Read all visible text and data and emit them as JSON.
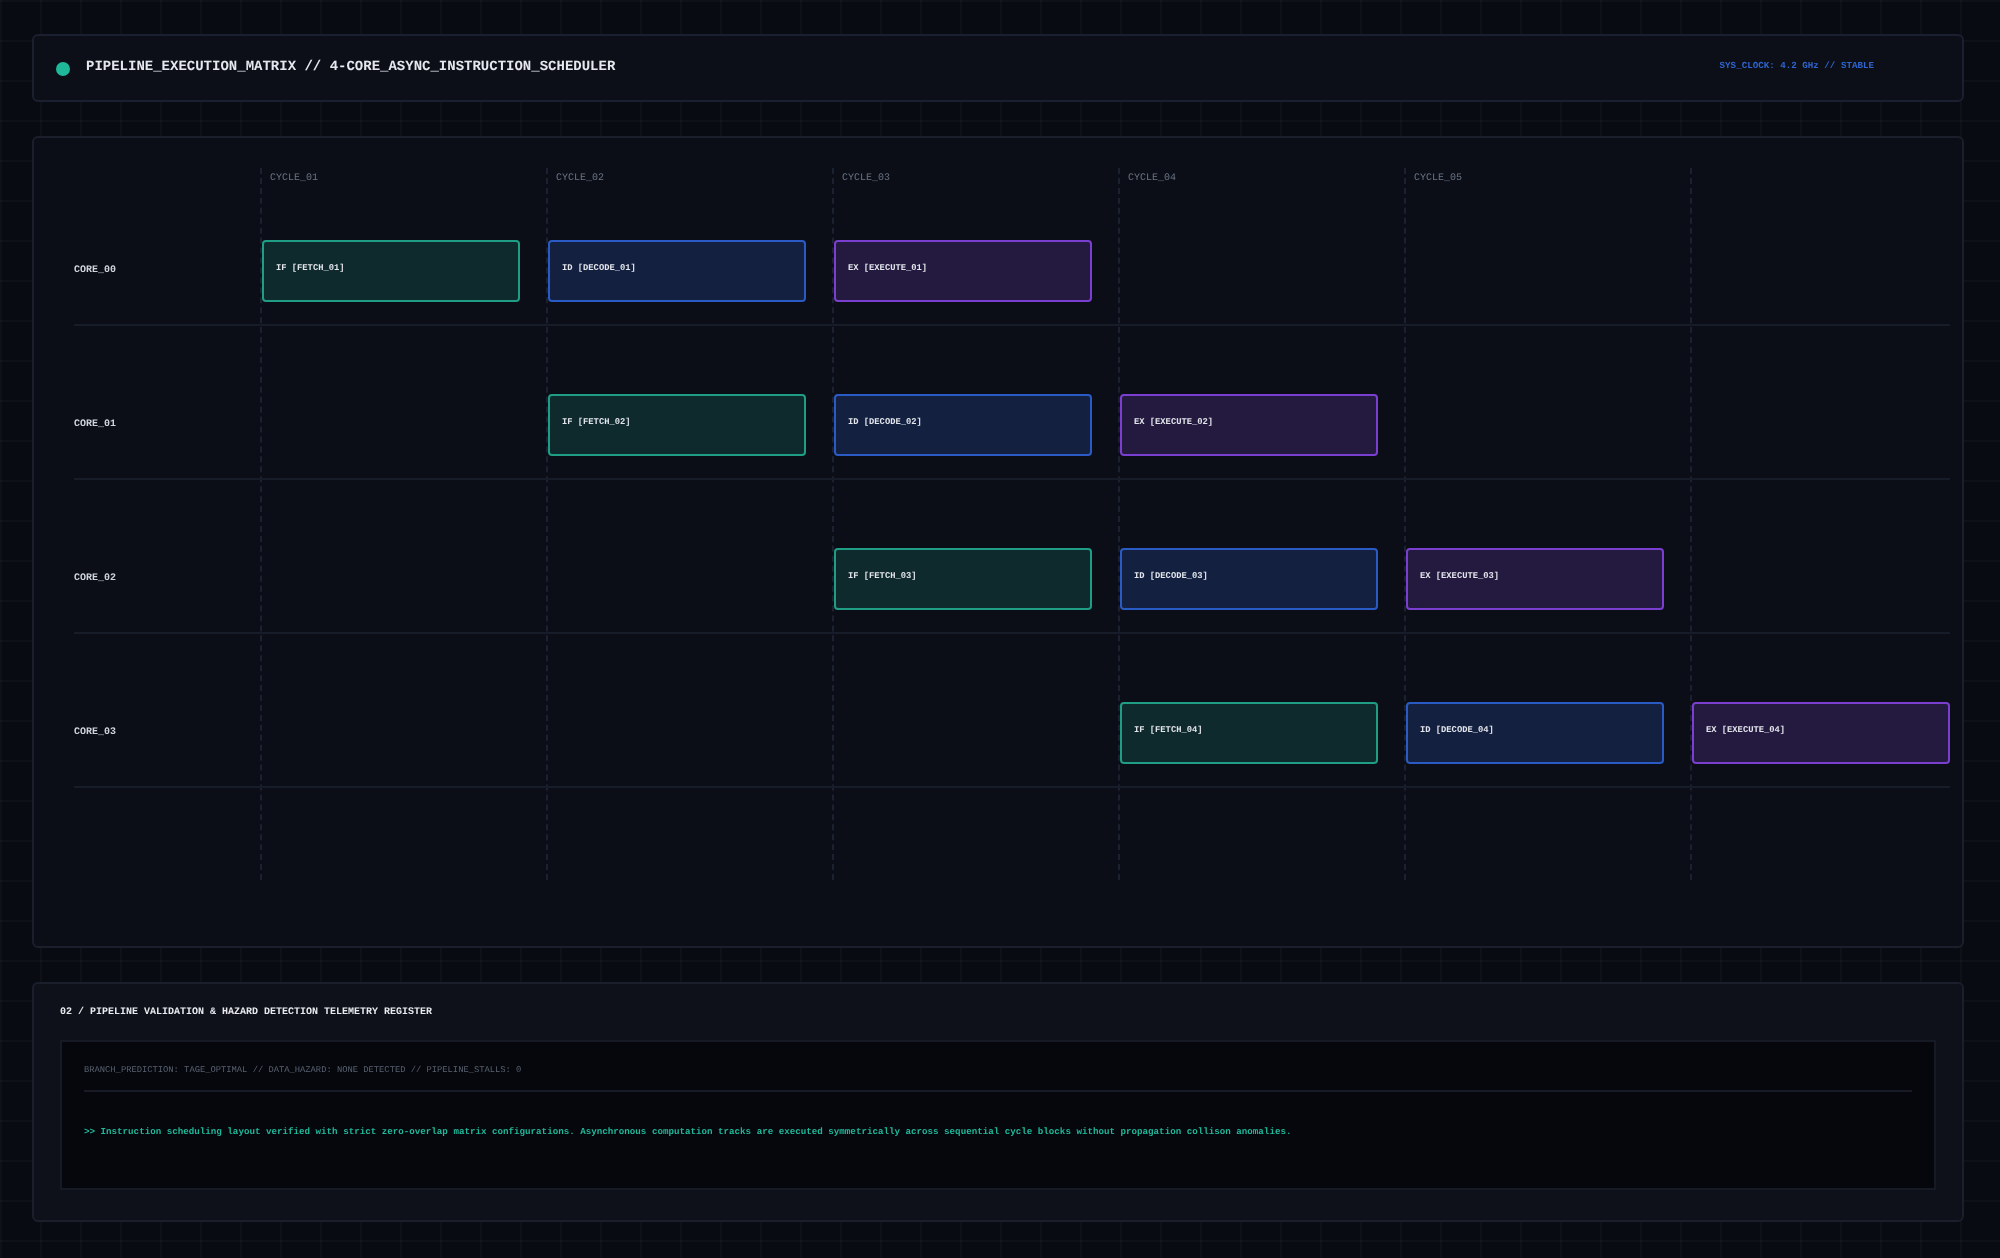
{
  "header": {
    "title": "PIPELINE_EXECUTION_MATRIX // 4-CORE_ASYNC_INSTRUCTION_SCHEDULER",
    "clock": "SYS_CLOCK: 4.2 GHz // STABLE"
  },
  "matrix": {
    "cycles": [
      "CYCLE_01",
      "CYCLE_02",
      "CYCLE_03",
      "CYCLE_04",
      "CYCLE_05"
    ],
    "cores": [
      {
        "name": "CORE_00",
        "stages": [
          {
            "kind": "fetch",
            "label": "IF [FETCH_01]"
          },
          {
            "kind": "decode",
            "label": "ID [DECODE_01]"
          },
          {
            "kind": "execute",
            "label": "EX [EXECUTE_01]"
          }
        ]
      },
      {
        "name": "CORE_01",
        "stages": [
          {
            "kind": "fetch",
            "label": "IF [FETCH_02]"
          },
          {
            "kind": "decode",
            "label": "ID [DECODE_02]"
          },
          {
            "kind": "execute",
            "label": "EX [EXECUTE_02]"
          }
        ]
      },
      {
        "name": "CORE_02",
        "stages": [
          {
            "kind": "fetch",
            "label": "IF [FETCH_03]"
          },
          {
            "kind": "decode",
            "label": "ID [DECODE_03]"
          },
          {
            "kind": "execute",
            "label": "EX [EXECUTE_03]"
          }
        ]
      },
      {
        "name": "CORE_03",
        "stages": [
          {
            "kind": "fetch",
            "label": "IF [FETCH_04]"
          },
          {
            "kind": "decode",
            "label": "ID [DECODE_04]"
          },
          {
            "kind": "execute",
            "label": "EX [EXECUTE_04]"
          }
        ]
      }
    ]
  },
  "telemetry": {
    "title": "02 / PIPELINE VALIDATION & HAZARD DETECTION TELEMETRY REGISTER",
    "status": "BRANCH_PREDICTION: TAGE_OPTIMAL // DATA_HAZARD: NONE DETECTED // PIPELINE_STALLS: 0",
    "log": ">> Instruction scheduling layout verified with strict zero-overlap matrix configurations. Asynchronous computation tracks are executed symmetrically across sequential cycle blocks without propagation collison anomalies."
  }
}
